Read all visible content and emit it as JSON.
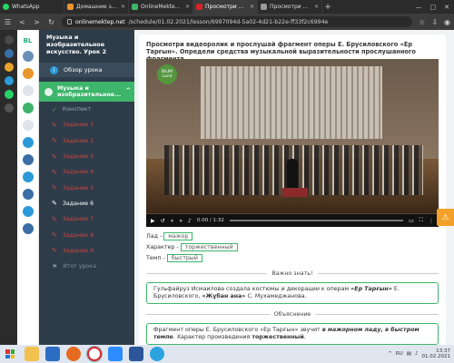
{
  "browser": {
    "tabs": [
      {
        "label": "WhatsApp",
        "color": "#25d366",
        "active": false
      },
      {
        "label": "Домашние задан",
        "color": "#e9962b",
        "active": false
      },
      {
        "label": "OnlineMektep - Bil",
        "color": "#3db56a",
        "active": true
      },
      {
        "label": "Просмотри видео",
        "color": "#d8232a",
        "active": false
      },
      {
        "label": "Просмотри видео",
        "color": "#999999",
        "active": false
      }
    ],
    "tab_new": "+",
    "url_domain": "onlinemektep.net",
    "url_path": "/schedule/01.02.2021/lesson/6997094d-5a02-4d21-b22e-ff33f2c6994e"
  },
  "lesson_sidebar": {
    "course_title": "Музыка и изобразительное искусство. Урок 2",
    "overview_label": "Обзор урока",
    "section_label": "Музыка и изобразительное...",
    "items": [
      {
        "label": "Конспект",
        "state": "done"
      },
      {
        "label": "Задание 1",
        "state": "red"
      },
      {
        "label": "Задание 2",
        "state": "red"
      },
      {
        "label": "Задание 3",
        "state": "red"
      },
      {
        "label": "Задание 4",
        "state": "red"
      },
      {
        "label": "Задание 5",
        "state": "red"
      },
      {
        "label": "Задание 6",
        "state": "current"
      },
      {
        "label": "Задание 7",
        "state": "red"
      },
      {
        "label": "Задание 8",
        "state": "red"
      },
      {
        "label": "Задание 9",
        "state": "red"
      },
      {
        "label": "Итог урока",
        "state": "gray"
      }
    ]
  },
  "task": {
    "question": "Просмотри видеоролик и прослушай фрагмент оперы Е. Брусиловского «Ер Тарғын». Определи средства музыкальной выразительности прослушанного фрагмента.",
    "video": {
      "logo_text": "BILIM Land",
      "time": "0:00 / 1:32"
    },
    "answers": [
      {
        "label": "Лад -",
        "value": "мажор"
      },
      {
        "label": "Характер -",
        "value": "торжественный"
      },
      {
        "label": "Темп -",
        "value": "быстрый"
      }
    ],
    "important_heading": "Важно знать!",
    "important_text_before": "Гульфайруз Исмаилова создала костюмы и декорации к операм ",
    "important_bold1": "«Ер Тарғын»",
    "important_text_mid": " Е. Брусиловского, ",
    "important_bold2": "«Жұбан ана»",
    "important_text_after": " С. Мухамеджанова.",
    "explanation_heading": "Объяснение",
    "explanation_before": "Фрагмент оперы Е. Брусиловского «Ер Тарғын» звучит ",
    "explanation_bold1": "в мажорном ладу, в быстром темпе",
    "explanation_mid": ". Характер произведения ",
    "explanation_bold2": "торжественный",
    "explanation_after": "."
  },
  "taskbar": {
    "language": "RU",
    "time": "13:37",
    "date": "01.02.2021"
  }
}
